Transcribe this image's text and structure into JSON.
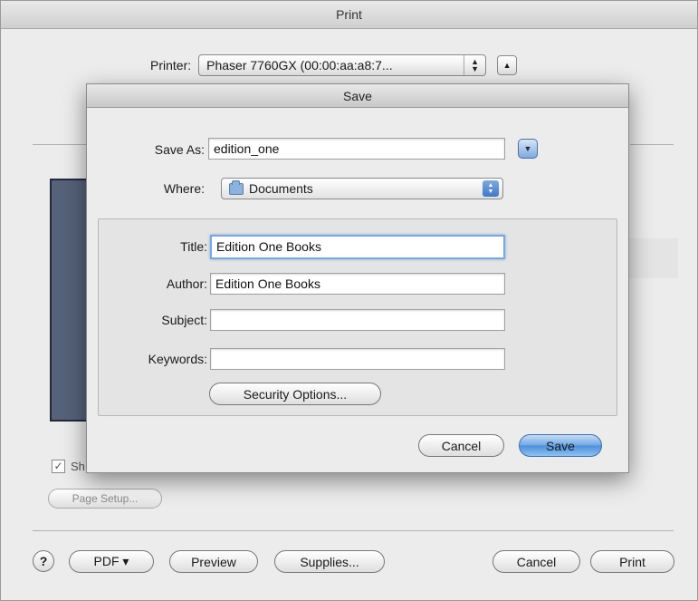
{
  "print_dialog": {
    "title": "Print",
    "printer_label": "Printer:",
    "printer_value": "Phaser 7760GX (00:00:aa:a8:7...",
    "show_checkbox_label": "Sh",
    "show_checkbox_checked": true,
    "page_setup_label": "Page Setup...",
    "help_label": "?",
    "pdf_label": "PDF ▾",
    "preview_label": "Preview",
    "supplies_label": "Supplies...",
    "cancel_label": "Cancel",
    "print_label": "Print"
  },
  "save_sheet": {
    "title": "Save",
    "save_as_label": "Save As:",
    "save_as_value": "edition_one",
    "where_label": "Where:",
    "where_value": "Documents",
    "title_label": "Title:",
    "title_value": "Edition One Books",
    "author_label": "Author:",
    "author_value": "Edition One Books",
    "subject_label": "Subject:",
    "subject_value": "",
    "keywords_label": "Keywords:",
    "keywords_value": "",
    "security_options_label": "Security Options...",
    "cancel_label": "Cancel",
    "save_label": "Save"
  },
  "icons": {
    "disclosure": "chevron-down-icon",
    "folder": "folder-icon",
    "help": "question-mark-icon"
  },
  "colors": {
    "accent": "#4c8fdc",
    "preview_fill": "#56627a"
  }
}
